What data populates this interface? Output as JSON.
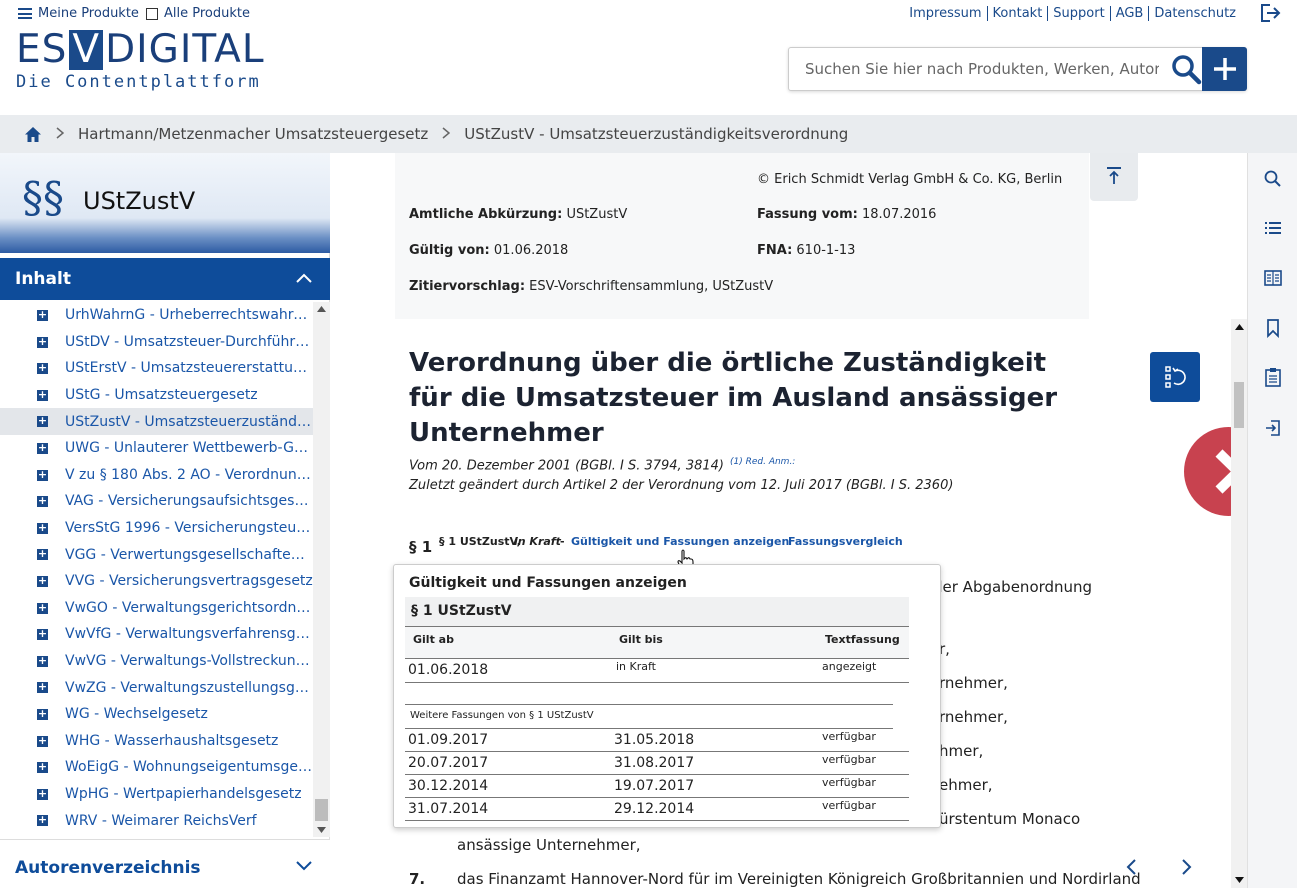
{
  "topnav": {
    "my_products": "Meine Produkte",
    "all_products": "Alle Produkte",
    "links": [
      "Impressum",
      "Kontakt",
      "Support",
      "AGB",
      "Datenschutz"
    ]
  },
  "logo": {
    "main_left": "ES",
    "main_v": "V",
    "main_right": "DIGITAL",
    "sub": "Die Contentplattform"
  },
  "search": {
    "placeholder": "Suchen Sie hier nach Produkten, Werken, Autoren"
  },
  "breadcrumb": {
    "items": [
      "Hartmann/Metzenmacher Umsatzsteuergesetz",
      "UStZustV - Umsatzsteuerzuständigkeitsverordnung"
    ]
  },
  "left": {
    "paragraph_sign": "§§",
    "title": "UStZustV",
    "inhalt_label": "Inhalt",
    "autoren_label": "Autorenverzeichnis",
    "toc": [
      "UrhWahrnG - Urheberrechtswahrneh...",
      "UStDV - Umsatzsteuer-Durchführung...",
      "UStErstV - Umsatzsteuererstattungsv...",
      "UStG - Umsatzsteuergesetz",
      "UStZustV - Umsatzsteuerzuständigkei...",
      "UWG - Unlauterer Wettbewerb-Gesetz",
      "V zu § 180 Abs. 2 AO - Verordnung z...",
      "VAG - Versicherungsaufsichtsgesetz",
      "VersStG 1996 - Versicherungsteuerg...",
      "VGG - Verwertungsgesellschaftenges...",
      "VVG - Versicherungsvertragsgesetz",
      "VwGO - Verwaltungsgerichtsordnung",
      "VwVfG - Verwaltungsverfahrensgesetz",
      "VwVG - Verwaltungs-Vollstreckungsg...",
      "VwZG - Verwaltungszustellungsgesetz",
      "WG - Wechselgesetz",
      "WHG - Wasserhaushaltsgesetz",
      "WoEigG - Wohnungseigentumsgesetz",
      "WpHG - Wertpapierhandelsgesetz",
      "WRV - Weimarer ReichsVerf"
    ],
    "active_index": 4
  },
  "meta": {
    "copyright": "© Erich Schmidt Verlag GmbH & Co. KG, Berlin",
    "abk_label": "Amtliche Abkürzung:",
    "abk_value": "UStZustV",
    "fassung_label": "Fassung vom:",
    "fassung_value": "18.07.2016",
    "gueltig_label": "Gültig von:",
    "gueltig_value": "01.06.2018",
    "fna_label": "FNA:",
    "fna_value": "610-1-13",
    "zitier_label": "Zitiervorschlag:",
    "zitier_value": "ESV-Vorschriftensammlung, UStZustV"
  },
  "document": {
    "title": "Verordnung über die örtliche Zuständigkeit für die Umsatzsteuer im Ausland ansässiger Unternehmer",
    "sub1": "Vom 20. Dezember 2001 (BGBl. I S. 3794, 3814)",
    "sub1_note": "(1) Red. Anm.:",
    "sub2": "Zuletzt geändert durch Artikel 2 der Verordnung vom 12. Juli 2017 (BGBl. I S. 2360)",
    "para_sign": "§ 1",
    "para_ref": "§ 1 UStZustV,",
    "para_status": "in Kraft",
    "para_dash": "-",
    "link_fassungen": "Gültigkeit und Fassungen anzeigen",
    "link_vergleich": "Fassungsvergleich",
    "body_fragments": [
      "der Abgabenordnung",
      "r,",
      "rnehmer,",
      "rnehmer,",
      "hmer,",
      "ehmer,",
      "ürstentum Monaco",
      "ansässige Unternehmer,"
    ],
    "item7_num": "7.",
    "item7_text": "das Finanzamt Hannover-Nord für im Vereinigten Königreich Großbritannien und Nordirland"
  },
  "popup": {
    "title": "Gültigkeit und Fassungen anzeigen",
    "section": "§ 1 UStZustV",
    "col_from": "Gilt ab",
    "col_to": "Gilt bis",
    "col_text": "Textfassung",
    "current": {
      "from": "01.06.2018",
      "to": "in Kraft",
      "text": "angezeigt"
    },
    "more_label": "Weitere Fassungen von § 1 UStZustV",
    "versions": [
      {
        "from": "01.09.2017",
        "to": "31.05.2018",
        "text": "verfügbar"
      },
      {
        "from": "20.07.2017",
        "to": "31.08.2017",
        "text": "verfügbar"
      },
      {
        "from": "30.12.2014",
        "to": "19.07.2017",
        "text": "verfügbar"
      },
      {
        "from": "31.07.2014",
        "to": "29.12.2014",
        "text": "verfügbar"
      }
    ]
  },
  "colors": {
    "brand": "#0e4c9a",
    "link": "#1a56a8",
    "next": "#c8424f"
  }
}
